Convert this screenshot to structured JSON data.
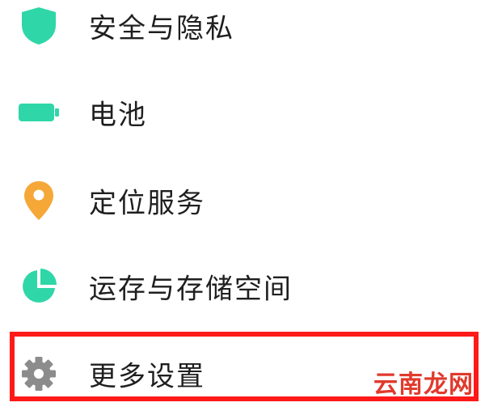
{
  "settings_list": {
    "items": [
      {
        "label": "安全与隐私",
        "icon": "shield-icon",
        "icon_color": "#2fd6a8"
      },
      {
        "label": "电池",
        "icon": "battery-icon",
        "icon_color": "#2fd6a8"
      },
      {
        "label": "定位服务",
        "icon": "location-pin-icon",
        "icon_color": "#f5a838"
      },
      {
        "label": "运存与存储空间",
        "icon": "pie-chart-icon",
        "icon_color": "#2fd6a8"
      },
      {
        "label": "更多设置",
        "icon": "gear-icon",
        "icon_color": "#8c8c8c"
      }
    ],
    "highlighted_item": "更多设置",
    "highlight_color": "#ff1a1a"
  },
  "watermark": {
    "text": "云南龙网",
    "color": "#e03a2c"
  }
}
